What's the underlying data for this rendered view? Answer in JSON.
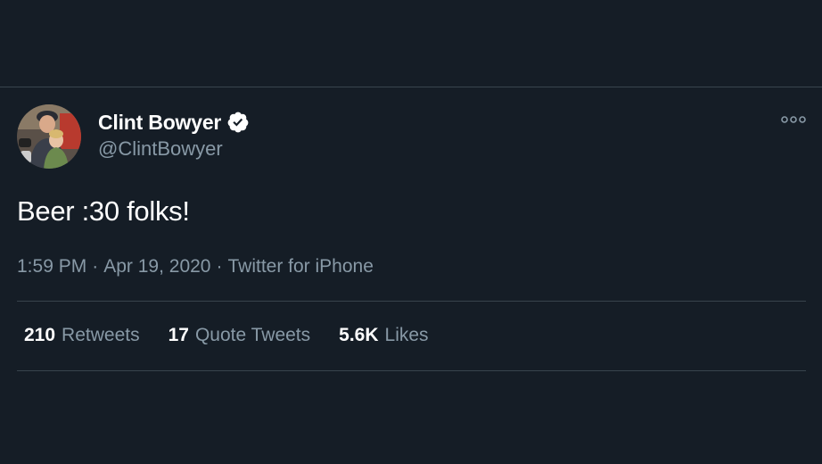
{
  "tweet": {
    "display_name": "Clint Bowyer",
    "handle": "@ClintBowyer",
    "verified_icon": "verified-badge-icon",
    "more_icon": "more-options-icon",
    "text": "Beer :30 folks!",
    "time": "1:59 PM",
    "date": "Apr 19, 2020",
    "source": "Twitter for iPhone",
    "separator": "·",
    "stats": {
      "retweets_count": "210",
      "retweets_label": "Retweets",
      "quotes_count": "17",
      "quotes_label": "Quote Tweets",
      "likes_count": "5.6K",
      "likes_label": "Likes"
    }
  },
  "colors": {
    "background": "#151d26",
    "primary_text": "#ffffff",
    "secondary_text": "#8899a6",
    "divider": "#38444d"
  }
}
